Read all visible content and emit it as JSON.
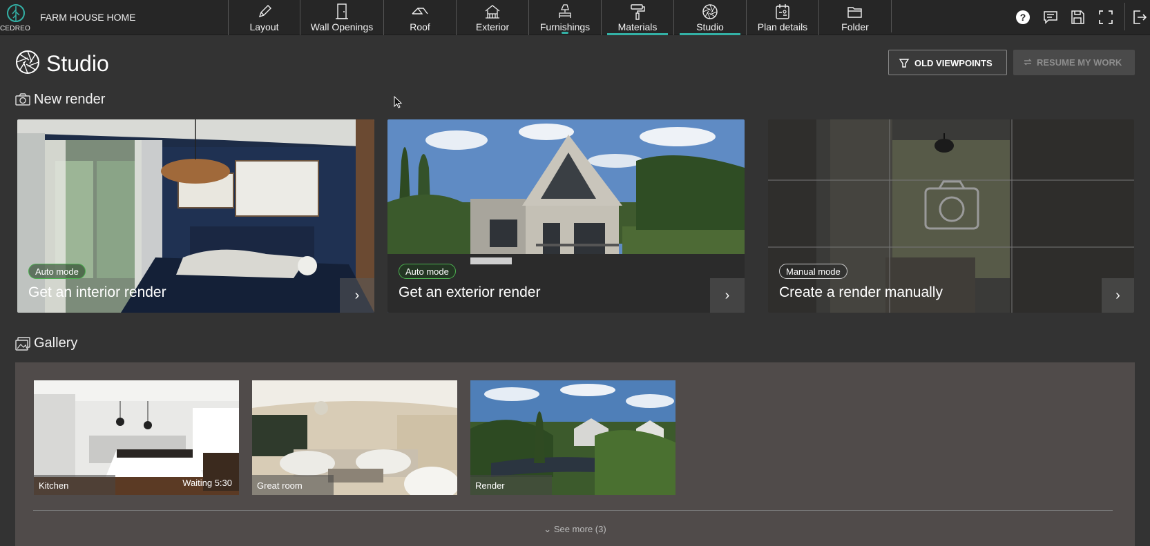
{
  "header": {
    "logo_text": "CEDREO",
    "project_name": "FARM HOUSE HOME",
    "tabs": [
      {
        "label": "Layout",
        "icon": "pencil-icon"
      },
      {
        "label": "Wall Openings",
        "icon": "door-icon"
      },
      {
        "label": "Roof",
        "icon": "roof-icon"
      },
      {
        "label": "Exterior",
        "icon": "exterior-icon"
      },
      {
        "label": "Furnishings",
        "icon": "lamp-icon"
      },
      {
        "label": "Materials",
        "icon": "paint-roller-icon"
      },
      {
        "label": "Studio",
        "icon": "aperture-icon",
        "active": true
      },
      {
        "label": "Plan details",
        "icon": "plan-details-icon"
      },
      {
        "label": "Folder",
        "icon": "folder-icon"
      }
    ],
    "right_icons": [
      "help-icon",
      "comment-icon",
      "save-icon",
      "fullscreen-icon",
      "logout-icon"
    ]
  },
  "page": {
    "title": "Studio",
    "old_viewpoints_label": "OLD VIEWPOINTS",
    "resume_label": "RESUME MY WORK"
  },
  "new_render": {
    "heading": "New render",
    "cards": [
      {
        "badge": "Auto mode",
        "title": "Get an interior render",
        "arrow": "›"
      },
      {
        "badge": "Auto mode",
        "title": "Get an exterior render",
        "arrow": "›"
      },
      {
        "badge": "Manual mode",
        "title": "Create a render manually",
        "arrow": "›"
      }
    ]
  },
  "gallery": {
    "heading": "Gallery",
    "items": [
      {
        "label": "Kitchen",
        "status": "Waiting 5:30"
      },
      {
        "label": "Great room",
        "status": ""
      },
      {
        "label": "Render",
        "status": ""
      }
    ],
    "see_more": "See more (3)"
  },
  "colors": {
    "accent": "#33b1a6",
    "background": "#333333",
    "topbar": "#262626",
    "gallery_bg": "#504b4a"
  }
}
